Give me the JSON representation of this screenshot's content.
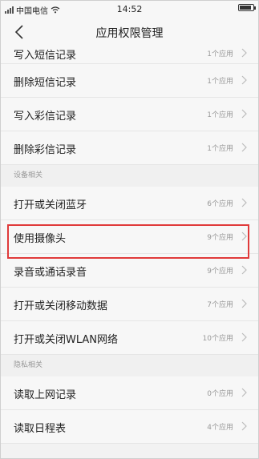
{
  "status_bar": {
    "carrier": "中国电信",
    "signal_text": "...",
    "time": "14:52"
  },
  "header": {
    "title": "应用权限管理"
  },
  "rows_top": [
    {
      "label": "写入短信记录",
      "count": "1个应用"
    },
    {
      "label": "删除短信记录",
      "count": "1个应用"
    },
    {
      "label": "写入彩信记录",
      "count": "1个应用"
    },
    {
      "label": "删除彩信记录",
      "count": "1个应用"
    }
  ],
  "section_device": "设备相关",
  "rows_device": [
    {
      "label": "打开或关闭蓝牙",
      "count": "6个应用"
    },
    {
      "label": "使用摄像头",
      "count": "9个应用"
    },
    {
      "label": "录音或通话录音",
      "count": "9个应用"
    },
    {
      "label": "打开或关闭移动数据",
      "count": "7个应用"
    },
    {
      "label": "打开或关闭WLAN网络",
      "count": "10个应用"
    }
  ],
  "section_privacy": "隐私相关",
  "rows_privacy": [
    {
      "label": "读取上网记录",
      "count": "0个应用"
    },
    {
      "label": "读取日程表",
      "count": "4个应用"
    }
  ],
  "colors": {
    "highlight": "#e03a3a"
  }
}
